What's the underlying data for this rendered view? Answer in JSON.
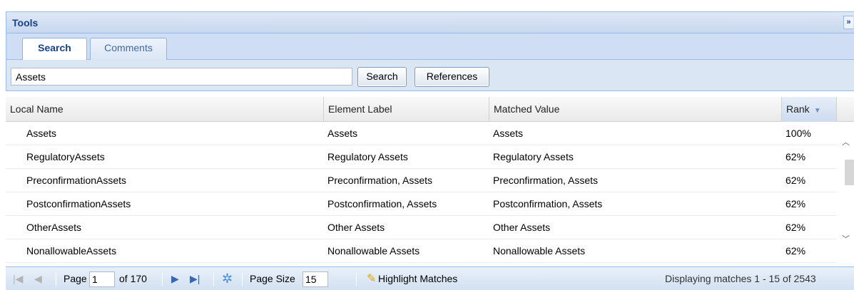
{
  "panel": {
    "title": "Tools",
    "collapse_glyph": "»"
  },
  "tabs": [
    {
      "label": "Search",
      "active": true
    },
    {
      "label": "Comments",
      "active": false
    }
  ],
  "toolbar": {
    "search_value": "Assets",
    "search_label": "Search",
    "references_label": "References"
  },
  "grid": {
    "columns": [
      "Local Name",
      "Element Label",
      "Matched Value",
      "Rank"
    ],
    "sort_column": "Rank",
    "sort_direction": "descending",
    "rows": [
      [
        "Assets",
        "Assets",
        "Assets",
        "100%"
      ],
      [
        "RegulatoryAssets",
        "Regulatory Assets",
        "Regulatory Assets",
        "62%"
      ],
      [
        "PreconfirmationAssets",
        "Preconfirmation, Assets",
        "Preconfirmation, Assets",
        "62%"
      ],
      [
        "PostconfirmationAssets",
        "Postconfirmation, Assets",
        "Postconfirmation, Assets",
        "62%"
      ],
      [
        "OtherAssets",
        "Other Assets",
        "Other Assets",
        "62%"
      ],
      [
        "NonallowableAssets",
        "Nonallowable Assets",
        "Nonallowable Assets",
        "62%"
      ]
    ]
  },
  "paging": {
    "page_label": "Page",
    "page_value": "1",
    "of_label": "of 170",
    "page_size_label": "Page Size",
    "page_size_value": "15",
    "highlight_label": "Highlight Matches",
    "status": "Displaying matches 1 - 15 of 2543"
  },
  "colors": {
    "header_text": "#15428b",
    "border": "#99bbe8",
    "nav_icon": "#3a67b0"
  }
}
